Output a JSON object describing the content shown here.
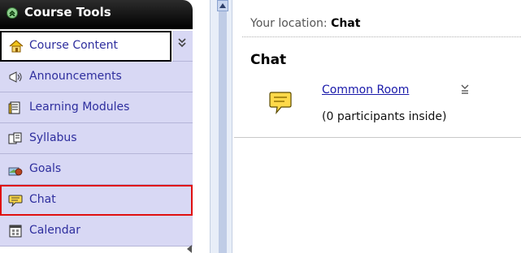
{
  "sidebar": {
    "title": "Course Tools",
    "items": [
      {
        "label": "Course Content",
        "icon": "home-icon"
      },
      {
        "label": "Announcements",
        "icon": "megaphone-icon"
      },
      {
        "label": "Learning Modules",
        "icon": "document-icon"
      },
      {
        "label": "Syllabus",
        "icon": "syllabus-icon"
      },
      {
        "label": "Goals",
        "icon": "goals-icon"
      },
      {
        "label": "Chat",
        "icon": "chat-bubble-icon"
      },
      {
        "label": "Calendar",
        "icon": "calendar-icon"
      }
    ]
  },
  "location": {
    "prefix": "Your location:",
    "current": "Chat"
  },
  "page": {
    "title": "Chat"
  },
  "room": {
    "name": "Common Room",
    "participants": "(0 participants inside)"
  },
  "colors": {
    "link": "#1a1aaa",
    "sidebar_bg": "#d8d8f4",
    "highlight_border": "#e01010"
  }
}
